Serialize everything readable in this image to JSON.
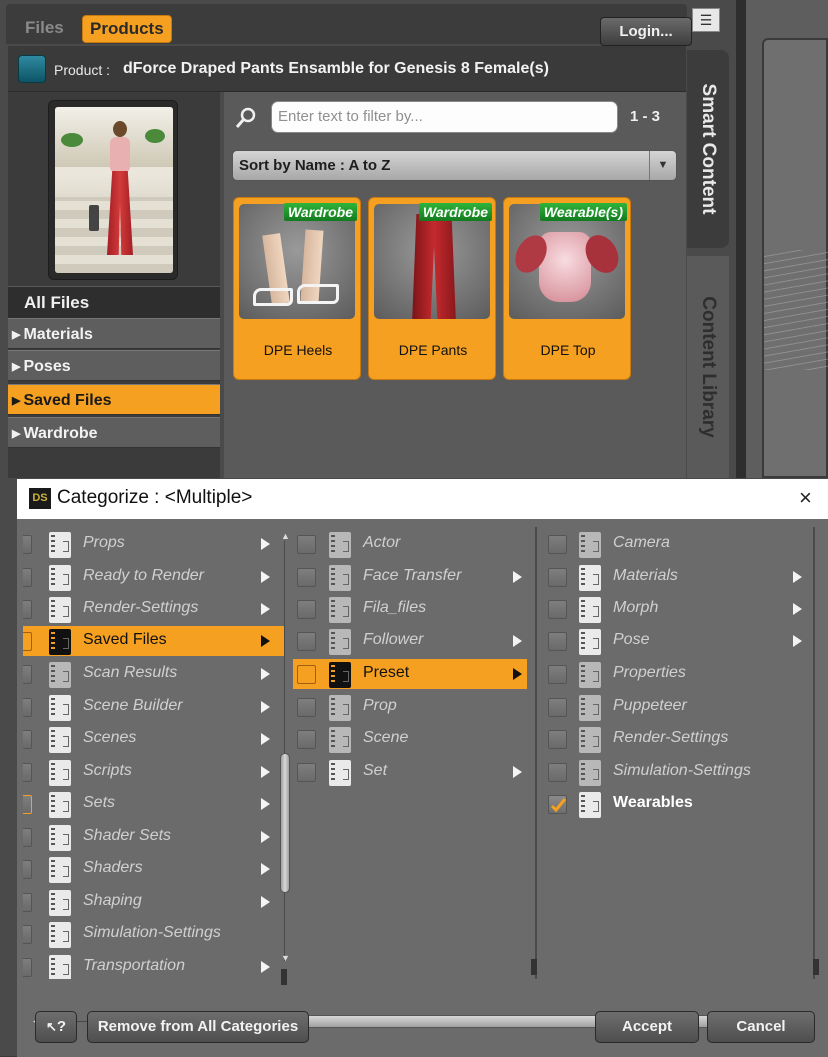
{
  "header": {
    "tabs": [
      "Files",
      "Products"
    ],
    "login_label": "Login...",
    "menu_icon": "☰"
  },
  "product": {
    "key": "Product :",
    "name": "dForce Draped Pants Ensamble for Genesis 8 Female(s)"
  },
  "side_tabs": {
    "smart_content": "Smart Content",
    "content_library": "Content Library"
  },
  "categories": {
    "all_files": "All Files",
    "items": [
      "Materials",
      "Poses",
      "Saved Files",
      "Wardrobe"
    ],
    "selected": "Saved Files"
  },
  "filter": {
    "placeholder": "Enter text to filter by...",
    "range": "1 - 3"
  },
  "sort": {
    "label": "Sort by Name : A to Z"
  },
  "cards": [
    {
      "badge": "Wardrobe",
      "label": "DPE Heels"
    },
    {
      "badge": "Wardrobe",
      "label": "DPE Pants"
    },
    {
      "badge": "Wearable(s)",
      "label": "DPE Top"
    }
  ],
  "dialog": {
    "app_icon": "DS",
    "title": "Categorize : <Multiple>",
    "close": "×",
    "col1": [
      "Props",
      "Ready to Render",
      "Render-Settings",
      "Saved Files",
      "Scan Results",
      "Scene Builder",
      "Scenes",
      "Scripts",
      "Sets",
      "Shader Sets",
      "Shaders",
      "Shaping",
      "Simulation-Settings",
      "Transportation"
    ],
    "col2": [
      "Actor",
      "Face Transfer",
      "Fila_files",
      "Follower",
      "Preset",
      "Prop",
      "Scene",
      "Set"
    ],
    "col3": [
      "Camera",
      "Materials",
      "Morph",
      "Pose",
      "Properties",
      "Puppeteer",
      "Render-Settings",
      "Simulation-Settings",
      "Wearables"
    ],
    "buttons": {
      "help": "?",
      "remove": "Remove from All Categories",
      "accept": "Accept",
      "cancel": "Cancel"
    }
  },
  "colors": {
    "accent": "#f5a020",
    "badge_green": "#1f9a2c"
  }
}
